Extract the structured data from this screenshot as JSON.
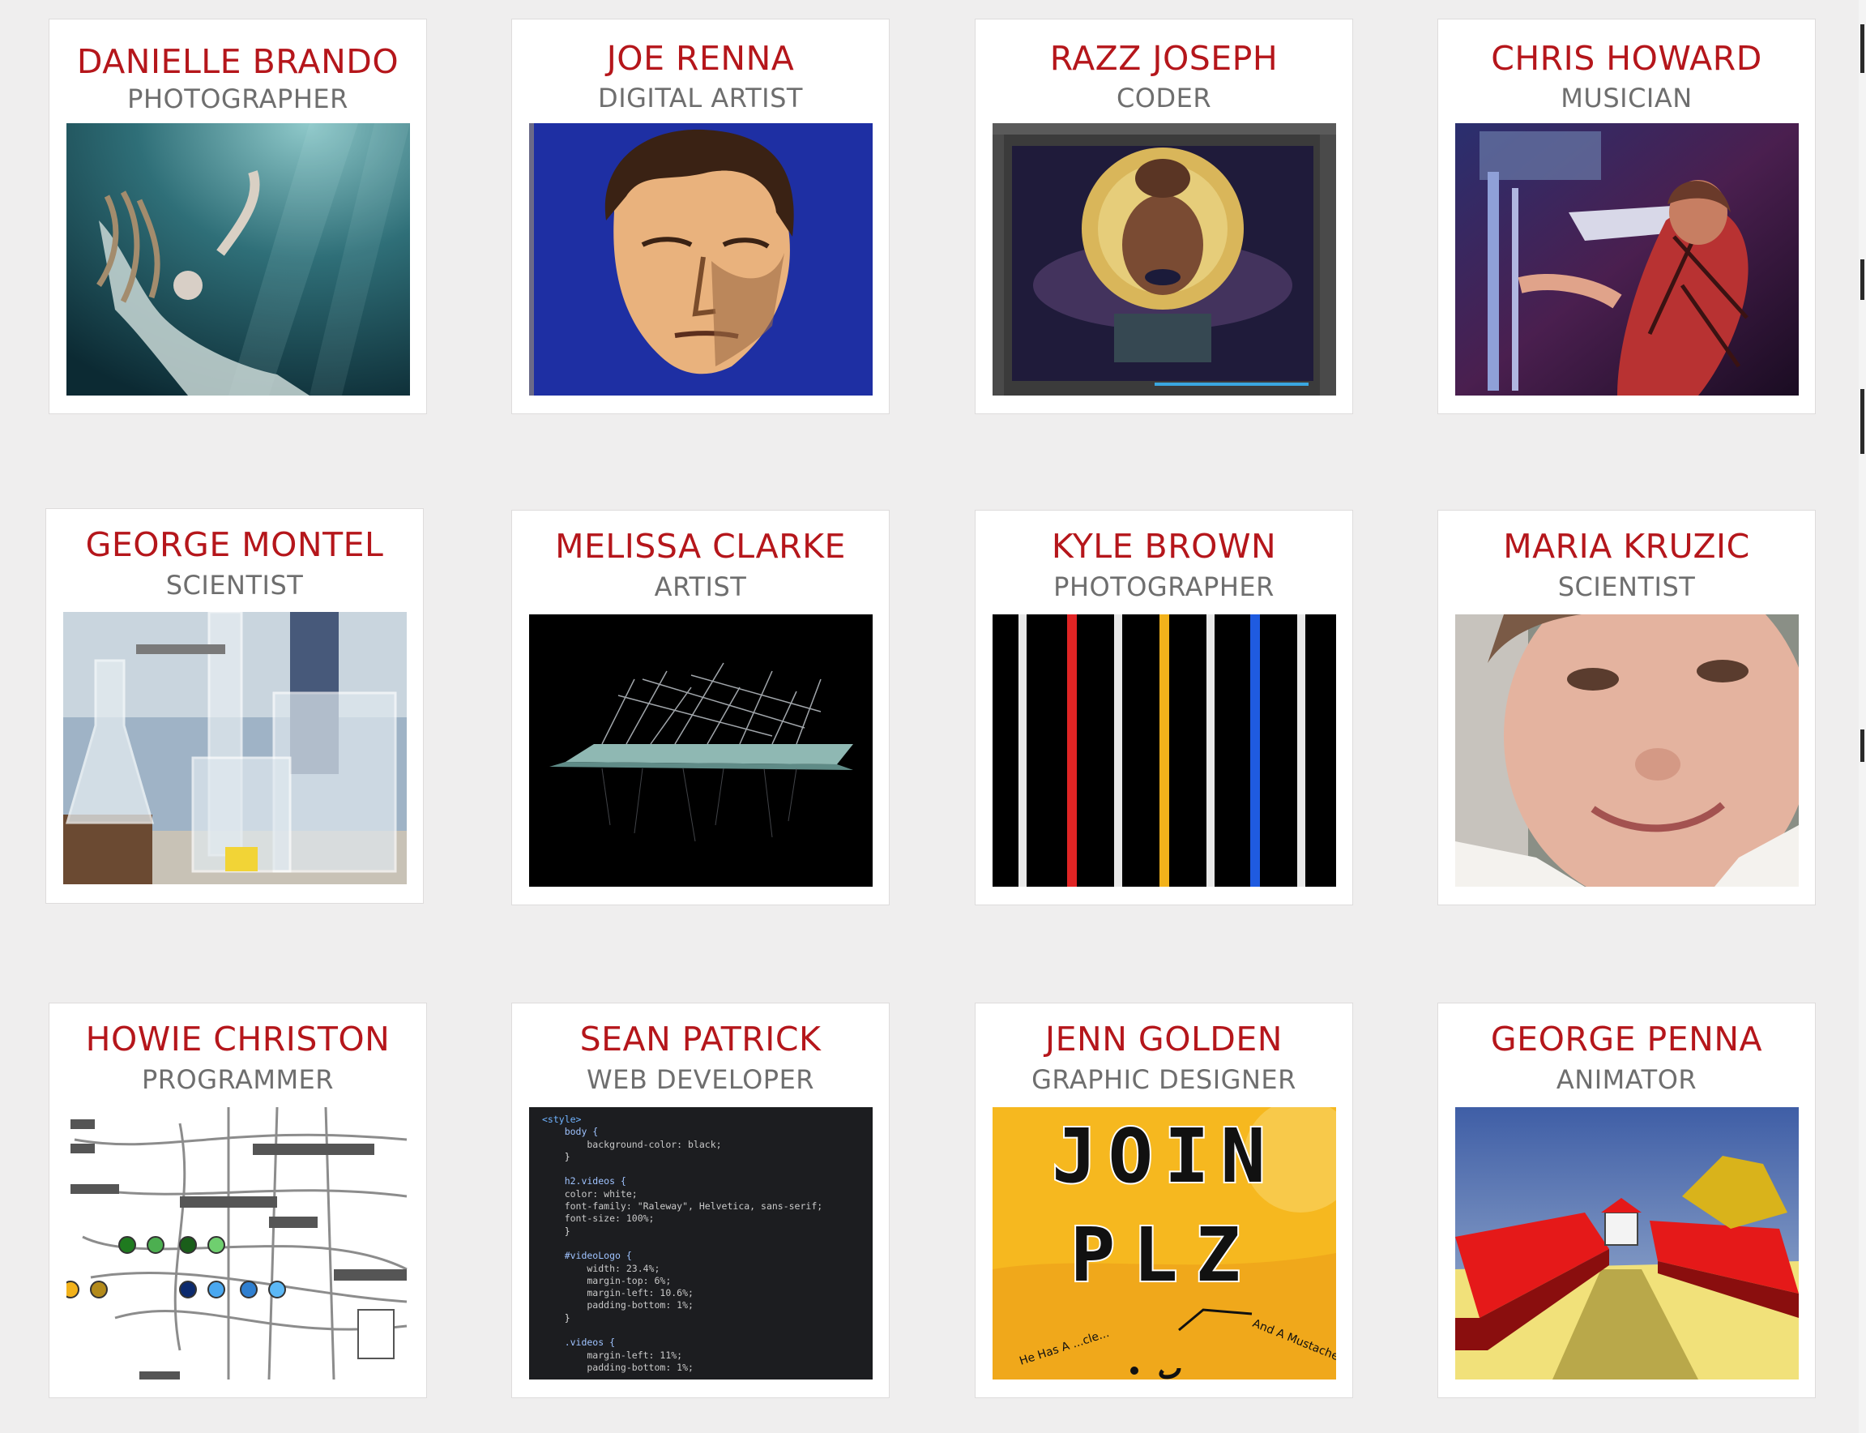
{
  "profiles": [
    {
      "name": "DANIELLE BRANDO",
      "role": "PHOTOGRAPHER"
    },
    {
      "name": "JOE RENNA",
      "role": "DIGITAL ARTIST"
    },
    {
      "name": "RAZZ JOSEPH",
      "role": "CODER"
    },
    {
      "name": "CHRIS HOWARD",
      "role": "MUSICIAN"
    },
    {
      "name": "GEORGE MONTEL",
      "role": "SCIENTIST"
    },
    {
      "name": "MELISSA CLARKE",
      "role": "ARTIST"
    },
    {
      "name": "KYLE BROWN",
      "role": "PHOTOGRAPHER"
    },
    {
      "name": "MARIA KRUZIC",
      "role": "SCIENTIST"
    },
    {
      "name": "HOWIE CHRISTON",
      "role": "PROGRAMMER"
    },
    {
      "name": "SEAN PATRICK",
      "role": "WEB DEVELOPER"
    },
    {
      "name": "JENN GOLDEN",
      "role": "GRAPHIC DESIGNER"
    },
    {
      "name": "GEORGE PENNA",
      "role": "ANIMATOR"
    }
  ],
  "artwork": {
    "poster_lines": [
      "JOIN",
      "PLZ"
    ],
    "poster_note_left": "He Has A ...cle...",
    "poster_note_right": "And A Mustache!!!",
    "code_lines": [
      "<style>",
      "    body {",
      "        background-color: black;",
      "    }",
      "",
      "    h2.videos {",
      "    color: white;",
      "    font-family: \"Raleway\", Helvetica, sans-serif;",
      "    font-size: 100%;",
      "    }",
      "",
      "    #videoLogo {",
      "        width: 23.4%;",
      "        margin-top: 6%;",
      "        margin-left: 10.6%;",
      "        padding-bottom: 1%;",
      "    }",
      "",
      "    .videos {",
      "        margin-left: 11%;",
      "        padding-bottom: 1%;"
    ]
  },
  "colors": {
    "name": "#b5161b",
    "role": "#6e6e6e",
    "background": "#efeeee"
  }
}
